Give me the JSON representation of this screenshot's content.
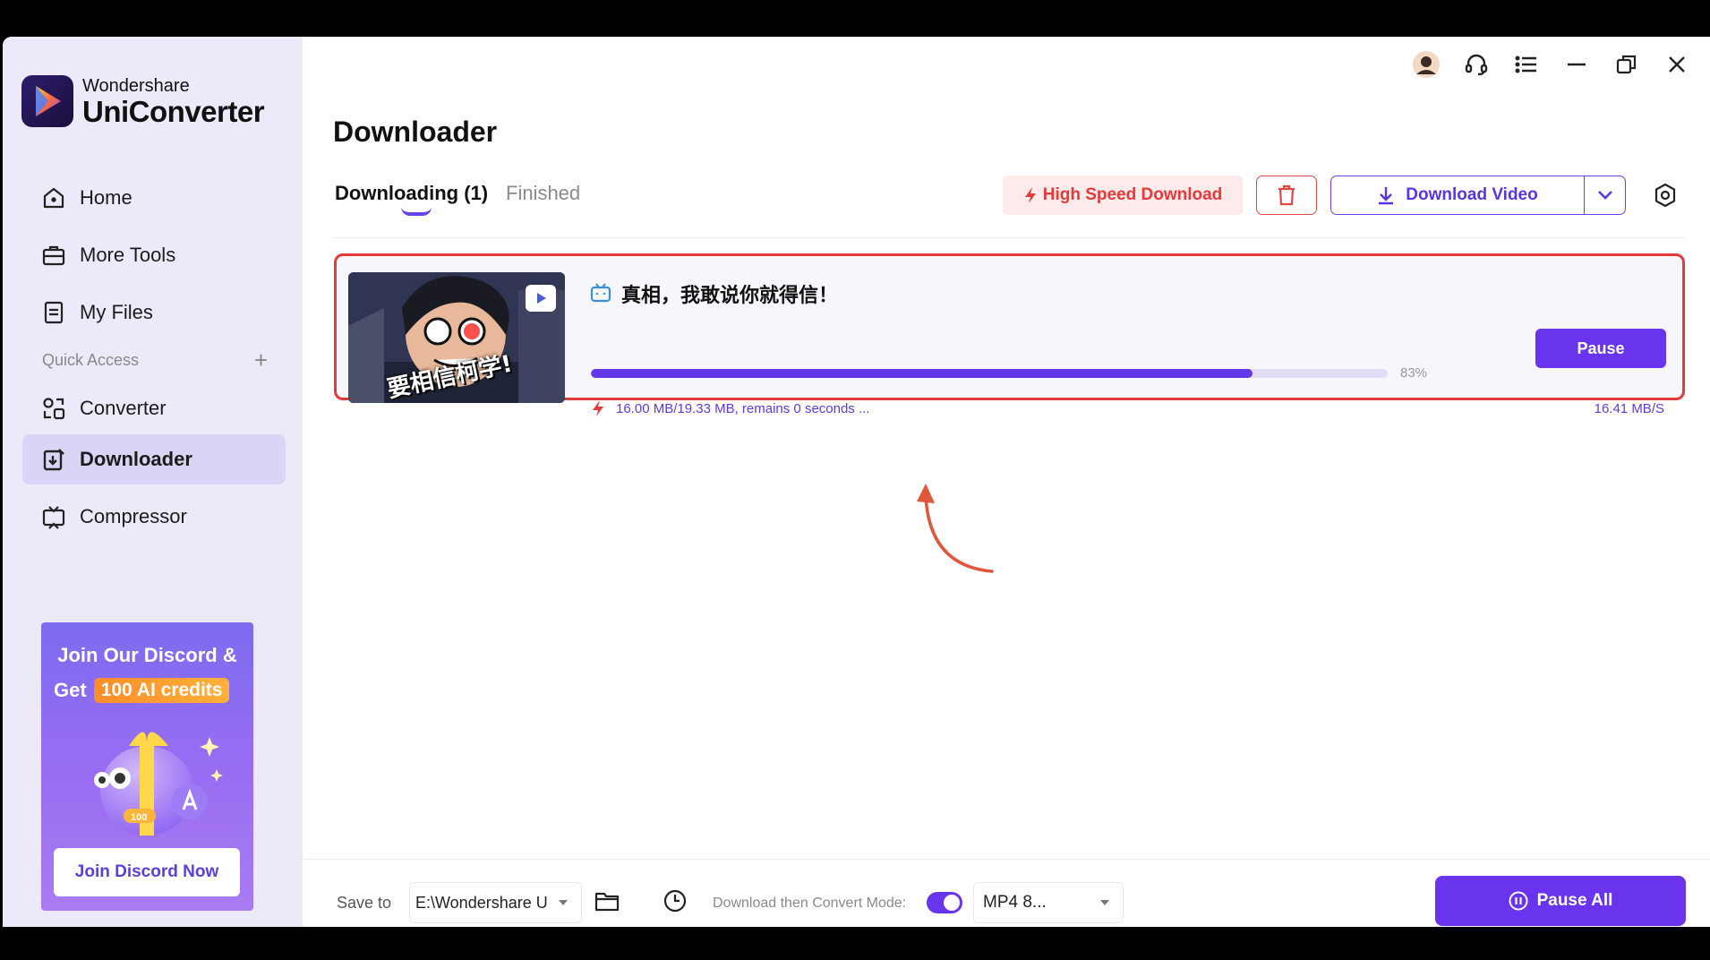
{
  "app": {
    "brand": "Wondershare",
    "product": "UniConverter"
  },
  "sidebar": {
    "items": [
      {
        "label": "Home",
        "icon": "home-icon"
      },
      {
        "label": "More Tools",
        "icon": "toolbox-icon"
      },
      {
        "label": "My Files",
        "icon": "file-icon"
      }
    ],
    "quick_access_label": "Quick Access",
    "quick_items": [
      {
        "label": "Converter",
        "icon": "converter-icon"
      },
      {
        "label": "Downloader",
        "icon": "downloader-icon",
        "active": true
      },
      {
        "label": "Compressor",
        "icon": "compressor-icon"
      }
    ],
    "promo": {
      "line1": "Join Our Discord &",
      "line2_prefix": "Get",
      "line2_badge": "100 AI credits",
      "button": "Join Discord Now"
    }
  },
  "main": {
    "title": "Downloader",
    "tabs": [
      {
        "label": "Downloading (1)",
        "active": true
      },
      {
        "label": "Finished",
        "active": false
      }
    ],
    "high_speed_label": "High Speed Download",
    "download_video_label": "Download Video",
    "task": {
      "title": "真相，我敢说你就得信！",
      "thumbnail_caption": "要相信柯学!",
      "progress_percent": 83,
      "progress_label": "83%",
      "pause_label": "Pause",
      "status": "16.00 MB/19.33 MB, remains 0 seconds ...",
      "speed": "16.41 MB/S"
    }
  },
  "bottom": {
    "save_to_label": "Save to",
    "save_path": "E:\\Wondershare U",
    "mode_label": "Download then Convert Mode:",
    "mode_enabled": true,
    "format": "MP4 8...",
    "pause_all_label": "Pause All"
  },
  "colors": {
    "accent": "#6a34ee",
    "danger": "#e23b3b",
    "sidebar_bg": "#eceaf8",
    "active_nav": "#dcd4f6"
  }
}
